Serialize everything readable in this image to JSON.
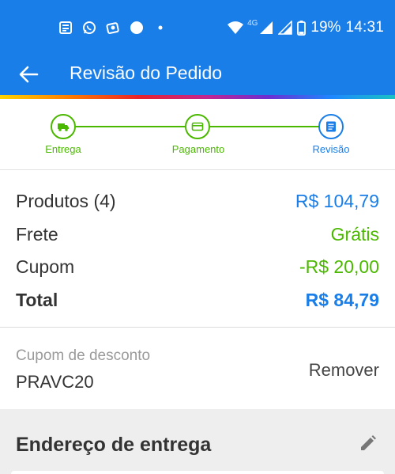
{
  "status_bar": {
    "battery": "19%",
    "time": "14:31",
    "network": "4G",
    "icons": [
      "news-icon",
      "whatsapp-icon",
      "app-icon",
      "dot-icon",
      "small-dot-icon",
      "wifi-icon",
      "signal-icon",
      "signal-icon-2",
      "battery-icon"
    ]
  },
  "app_bar": {
    "title": "Revisão do Pedido",
    "back_icon": "arrow-left-icon"
  },
  "stepper": {
    "steps": [
      {
        "label": "Entrega",
        "icon": "truck-icon",
        "state": "done"
      },
      {
        "label": "Pagamento",
        "icon": "card-icon",
        "state": "done"
      },
      {
        "label": "Revisão",
        "icon": "list-icon",
        "state": "current"
      }
    ],
    "colors": {
      "done": "#4bb800",
      "current": "#1a7ee8"
    }
  },
  "summary": {
    "rows": [
      {
        "label": "Produtos (4)",
        "value": "R$ 104,79"
      },
      {
        "label": "Frete",
        "value": "Grátis"
      },
      {
        "label": "Cupom",
        "value": "-R$ 20,00"
      },
      {
        "label": "Total",
        "value": "R$ 84,79"
      }
    ]
  },
  "coupon": {
    "label": "Cupom de desconto",
    "code": "PRAVC20",
    "remove_label": "Remover"
  },
  "address": {
    "heading": "Endereço de entrega",
    "edit_icon": "pencil-icon"
  },
  "colors": {
    "primary": "#1a7ee8",
    "success": "#4bb800"
  }
}
